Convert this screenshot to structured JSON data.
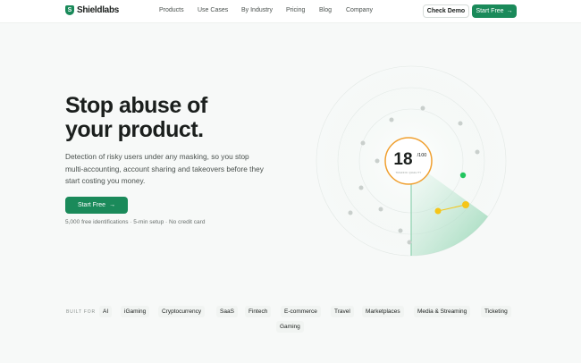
{
  "brand": {
    "name": "Shieldlabs",
    "accent": "#1a8a5a"
  },
  "nav": {
    "items": [
      "Products",
      "Use Cases",
      "By Industry",
      "Pricing",
      "Blog",
      "Company"
    ],
    "check_demo": "Check Demo",
    "start_free": "Start Free",
    "arrow": "→"
  },
  "hero": {
    "title_line1": "Stop abuse of",
    "title_line2": "your product.",
    "desc_line1": "Detection of risky users under any masking, so you stop",
    "desc_line2": "multi-accounting, account sharing and takeovers before they",
    "desc_line3": "start costing you money.",
    "cta": "Start Free",
    "note": "5,000 free identifications · 5-min setup · No credit card"
  },
  "score": {
    "value": "18",
    "max": "/100",
    "label": "TRAFFIC QUALITY"
  },
  "built_for": {
    "label": "BUILT FOR",
    "tags": [
      "AI",
      "iGaming",
      "Cryptocurrency",
      "SaaS",
      "Fintech",
      "E-commerce",
      "Travel",
      "Marketplaces",
      "Media & Streaming",
      "Ticketing",
      "Gaming"
    ]
  }
}
